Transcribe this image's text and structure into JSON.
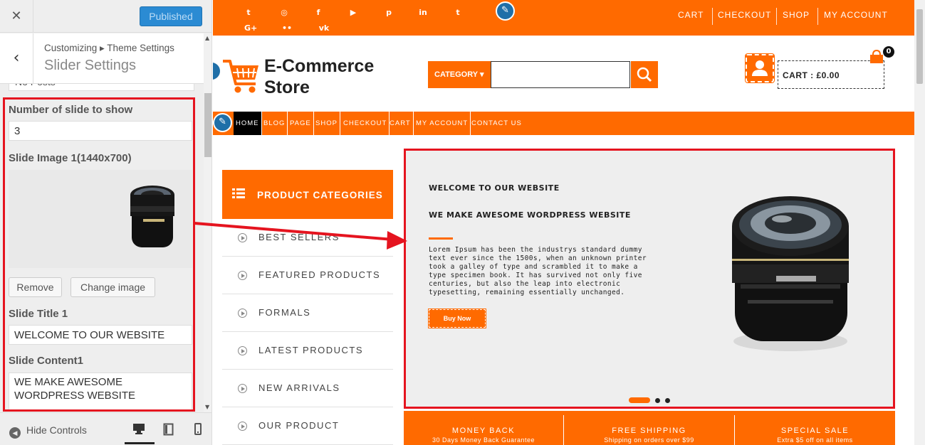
{
  "sidebar": {
    "close_glyph": "✕",
    "publish_label": "Published",
    "back_glyph": "‹",
    "breadcrumb": "Customizing ▸ Theme Settings",
    "section_title": "Slider Settings",
    "prev_field_value": "No Posts",
    "fields": {
      "num_slides_label": "Number of slide to show",
      "num_slides_value": "3",
      "slide_image_label": "Slide Image 1(1440x700)",
      "remove_label": "Remove",
      "change_image_label": "Change image",
      "slide_title_label": "Slide Title 1",
      "slide_title_value": "WELCOME TO OUR WEBSITE",
      "slide_content_label": "Slide Content1",
      "slide_content_value": "WE MAKE AWESOME WORDPRESS WEBSITE"
    },
    "footer": {
      "hide_controls_label": "Hide Controls"
    }
  },
  "preview": {
    "topbar": {
      "social_icons": [
        {
          "name": "twitter-icon",
          "glyph": "t"
        },
        {
          "name": "instagram-icon",
          "glyph": "◎"
        },
        {
          "name": "facebook-icon",
          "glyph": "f"
        },
        {
          "name": "youtube-icon",
          "glyph": "▶"
        },
        {
          "name": "pinterest-icon",
          "glyph": "p"
        },
        {
          "name": "linkedin-icon",
          "glyph": "in"
        },
        {
          "name": "tumblr-icon",
          "glyph": "t"
        },
        {
          "name": "google-plus-icon",
          "glyph": "G+"
        },
        {
          "name": "flickr-icon",
          "glyph": "••"
        },
        {
          "name": "vk-icon",
          "glyph": "vk"
        }
      ],
      "links": [
        "CART",
        "CHECKOUT",
        "SHOP",
        "MY ACCOUNT"
      ]
    },
    "logo_line1": "E-Commerce",
    "logo_line2": "Store",
    "category_button": "CATEGORY ▾",
    "cart_label": "CART : £0.00",
    "cart_count": "0",
    "nav": [
      "HOME",
      "BLOG",
      "PAGE",
      "SHOP",
      "CHECKOUT",
      "CART",
      "MY ACCOUNT",
      "CONTACT US"
    ],
    "categories_header": "PRODUCT CATEGORIES",
    "categories": [
      "BEST SELLERS",
      "FEATURED PRODUCTS",
      "FORMALS",
      "LATEST PRODUCTS",
      "NEW ARRIVALS",
      "OUR PRODUCT"
    ],
    "slider": {
      "heading1": "WELCOME TO OUR WEBSITE",
      "heading2": "WE MAKE AWESOME WORDPRESS WEBSITE",
      "paragraph": "Lorem Ipsum has been the industrys standard dummy text ever since the 1500s, when an unknown printer took a galley of type and scrambled it to make a type specimen book. It has survived not only five centuries, but also the leap into electronic typesetting, remaining essentially unchanged.",
      "button": "Buy Now"
    },
    "features": [
      {
        "title": "MONEY BACK",
        "sub": "30 Days Money Back Guarantee"
      },
      {
        "title": "FREE SHIPPING",
        "sub": "Shipping on orders over $99"
      },
      {
        "title": "SPECIAL SALE",
        "sub": "Extra $5 off on all items"
      }
    ]
  },
  "colors": {
    "accent": "#ff6a00",
    "highlight": "#e5141f",
    "publish_blue": "#2b8bd3"
  }
}
